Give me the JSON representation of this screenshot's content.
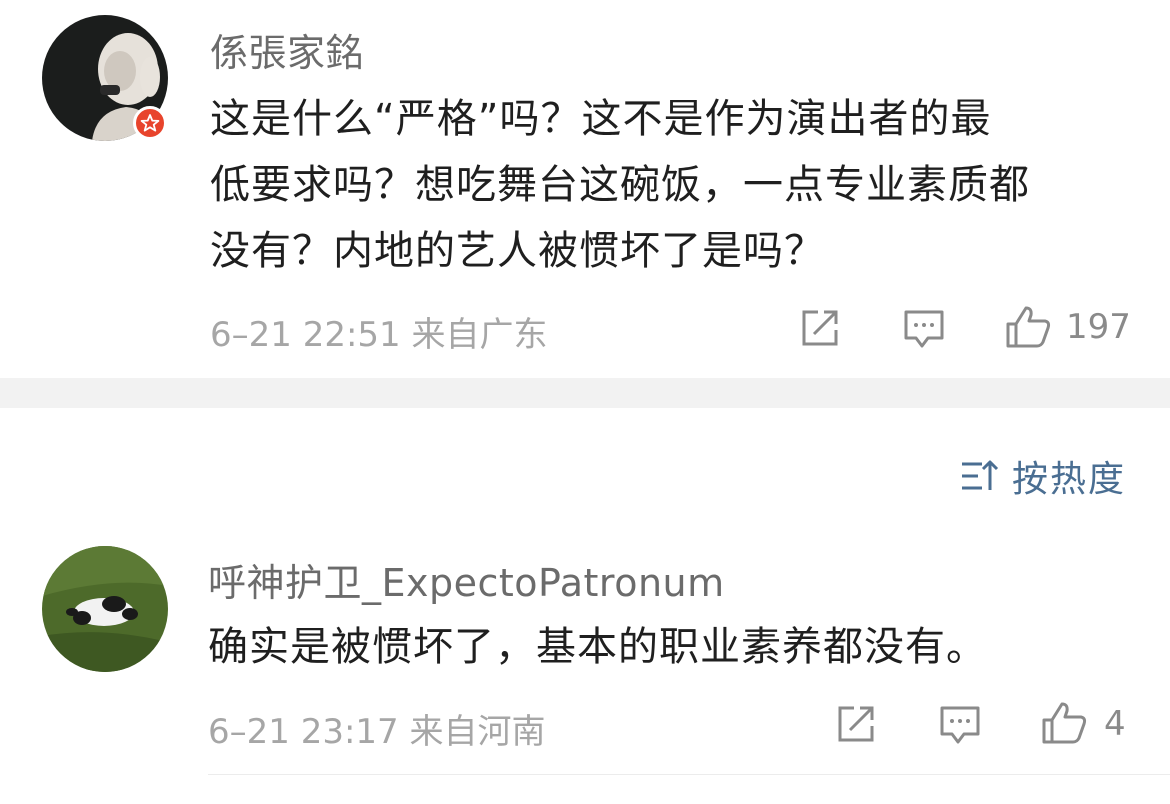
{
  "comments": [
    {
      "username": "係張家銘",
      "text_lines": [
        "这是什么“严格”吗？这不是作为演出者的最",
        "低要求吗？想吃舞台这碗饭，一点专业素质都",
        "没有？内地的艺人被惯坏了是吗？"
      ],
      "meta": "6–21 22:51 来自广东",
      "likes": "197",
      "icons": [
        "share-icon",
        "reply-icon",
        "thumbs-up-icon"
      ],
      "badge_icon": "star-badge-icon"
    },
    {
      "username": "呼神护卫_ExpectoPatronum",
      "text_lines": [
        "确实是被惯坏了，基本的职业素养都没有。"
      ],
      "meta": "6–21 23:17 来自河南",
      "likes": "4",
      "icons": [
        "share-icon",
        "reply-icon",
        "thumbs-up-icon"
      ]
    }
  ],
  "sort": {
    "label": "按热度",
    "icon": "sort-icon"
  },
  "colors": {
    "username": "#6b6b6b",
    "text": "#1f1f1f",
    "meta": "#a6a6a6",
    "link": "#4a6e92",
    "badge": "#e8442c",
    "divider": "#f2f2f2"
  }
}
